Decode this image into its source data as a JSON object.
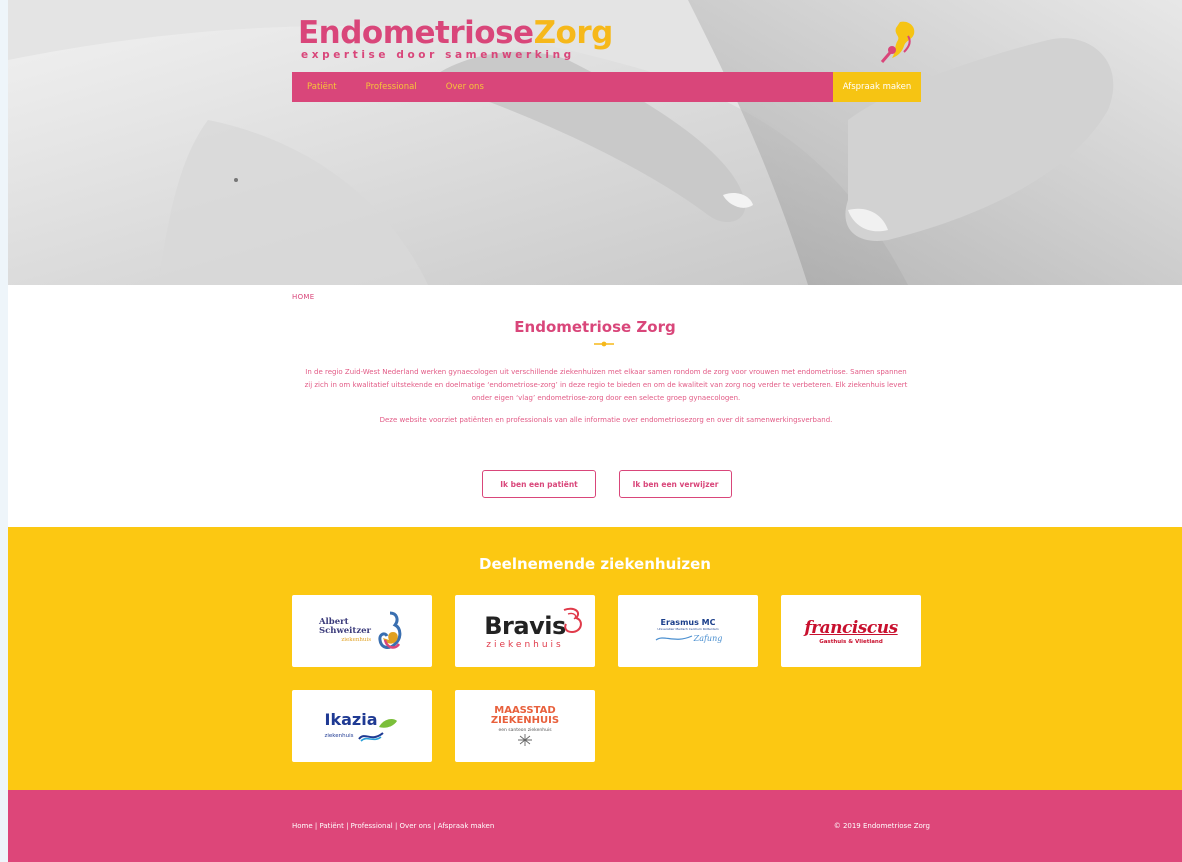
{
  "brand": {
    "name_part1": "Endometriose",
    "name_part2": "Zorg",
    "tagline": "expertise door samenwerking",
    "pink": "#d9467a",
    "yellow": "#f6c413"
  },
  "nav": {
    "items": [
      {
        "label": "Patiënt"
      },
      {
        "label": "Professional"
      },
      {
        "label": "Over ons"
      }
    ],
    "cta_label": "Afspraak maken"
  },
  "breadcrumb": {
    "home_label": "HOME"
  },
  "intro": {
    "title": "Endometriose Zorg",
    "paragraph1": "In de regio Zuid-West Nederland werken gynaecologen uit verschillende ziekenhuizen met elkaar samen rondom de zorg voor vrouwen met endometriose. Samen spannen zij zich in om kwalitatief uitstekende en doelmatige ‘endometriose-zorg’ in deze regio te bieden en om de kwaliteit van zorg nog verder te verbeteren. Elk ziekenhuis levert onder eigen ‘vlag’ endometriose-zorg door een selecte groep gynaecologen.",
    "paragraph2": "Deze website voorziet patiënten en professionals van alle informatie over endometriosezorg en over dit samenwerkingsverband."
  },
  "buttons": {
    "patient_label": "Ik ben een patiënt",
    "referrer_label": "Ik ben een verwijzer"
  },
  "hospitals": {
    "title": "Deelnemende ziekenhuizen",
    "logos": {
      "albert": {
        "line1": "Albert",
        "line2": "Schweitzer",
        "line3": "ziekenhuis"
      },
      "bravis": {
        "line1": "Bravis",
        "line2": "ziekenhuis"
      },
      "erasmus": {
        "line1": "Erasmus MC",
        "line2": "Universitair Medisch Centrum Rotterdam",
        "line3": "Zafung"
      },
      "franciscus": {
        "line1": "franciscus",
        "line2": "Gasthuis & Vlietland"
      },
      "ikazia": {
        "line1": "Ikazia",
        "line2": "ziekenhuis"
      },
      "maasstad": {
        "line1": "MAASSTAD",
        "line2": "ZIEKENHUIS",
        "line3": "een santeon ziekenhuis"
      }
    }
  },
  "footer": {
    "links": "Home | Patiënt | Professional | Over ons | Afspraak maken",
    "copyright": "© 2019 Endometriose Zorg"
  }
}
